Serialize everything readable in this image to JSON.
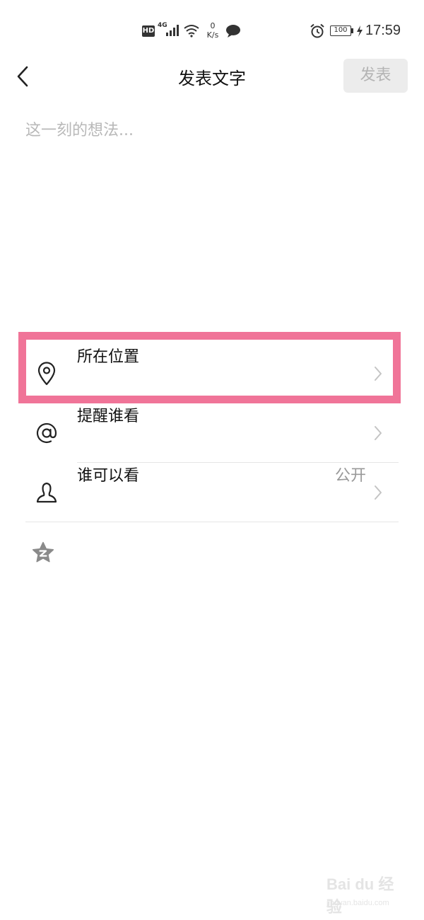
{
  "status_bar": {
    "hd_badge": "HD",
    "network": "4G",
    "speed_value": "0",
    "speed_unit": "K/s",
    "battery": "100",
    "time": "17:59"
  },
  "nav": {
    "back_icon": "chevron-left-icon",
    "title": "发表文字",
    "publish_label": "发表",
    "publish_enabled": false
  },
  "composer": {
    "value": "",
    "placeholder": "这一刻的想法..."
  },
  "options": [
    {
      "icon": "location-pin-icon",
      "label": "所在位置",
      "value": ""
    },
    {
      "icon": "at-sign-icon",
      "label": "提醒谁看",
      "value": ""
    },
    {
      "icon": "person-icon",
      "label": "谁可以看",
      "value": "公开"
    }
  ],
  "extra_icon": "star-badge-icon",
  "highlight": {
    "color": "#f07498",
    "target": "所在位置"
  },
  "watermark": {
    "logo_text": "Bai du 经验",
    "site": "jingyan.baidu.com"
  },
  "colors": {
    "publish_disabled_bg": "#ececec",
    "publish_disabled_text": "#b4b4b4",
    "placeholder": "#b8b8b8",
    "secondary_text": "#999999",
    "divider": "#e6e6e6"
  }
}
